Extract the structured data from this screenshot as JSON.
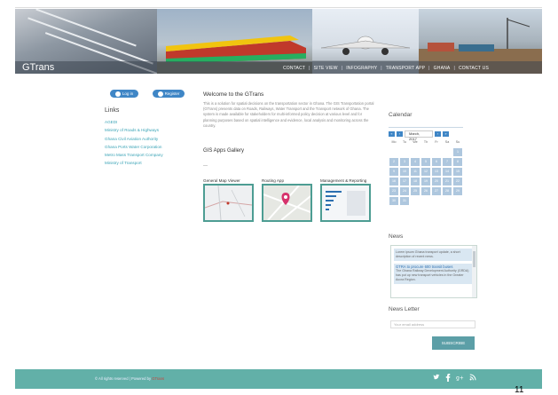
{
  "header": {
    "brand": "GTrans",
    "nav": [
      "CONTACT",
      "SITE VIEW",
      "INFOGRAPHY",
      "TRANSPORT APP",
      "GHANA",
      "CONTACT US"
    ]
  },
  "auth": {
    "login_label": "Log in",
    "register_label": "Register"
  },
  "links": {
    "title": "Links",
    "items": [
      "AGEDI",
      "Ministry of Roads & Highways",
      "Ghana Civil Aviation Authority",
      "Ghana Ports Water Corporation",
      "Metro Mass Transport Company",
      "Ministry of Transport"
    ]
  },
  "welcome": {
    "title": "Welcome to the GTrans",
    "body": "This is a solution for spatial decisions on the transportation sector in Ghana. The GIS Transportation portal (GTrans) presents data on Roads, Railways, Water Transport and the Transport network of Ghana. The system is made available for stakeholders for multi-informed policy decision at various level and for planning purposes based on spatial intelligence and evidence, local analysis and monitoring across the country."
  },
  "gallery": {
    "title": "GIS Apps Gallery",
    "dash": "—",
    "items": [
      {
        "label": "General Map Viewer"
      },
      {
        "label": "Routing App"
      },
      {
        "label": "Management & Reporting"
      }
    ]
  },
  "calendar": {
    "title": "Calendar",
    "month": "March, 2017",
    "prev": "«",
    "prev2": "‹",
    "next": "›",
    "next2": "»",
    "weekdays": [
      "Mo",
      "Tu",
      "We",
      "Th",
      "Fr",
      "Sa",
      "Su"
    ],
    "days": [
      "1",
      "2",
      "3",
      "4",
      "5",
      "6",
      "7",
      "8",
      "9",
      "10",
      "11",
      "12",
      "13",
      "14",
      "15",
      "16",
      "17",
      "18",
      "19",
      "20",
      "21",
      "22",
      "23",
      "24",
      "25",
      "26",
      "27",
      "28",
      "29",
      "30",
      "31"
    ]
  },
  "news": {
    "title": "News",
    "items": [
      {
        "text": "Lorem ipsum Ghana transport update, a short description of recent news."
      },
      {
        "link": "GTRA to procure 600 transit buses",
        "text": "The Ghana Railway Development Authority (GRDA) has put up new transport vehicles in the Greater Accra Region."
      }
    ]
  },
  "newsletter": {
    "title": "News Letter",
    "placeholder": "Your email address",
    "button": "SUBSCRIBE"
  },
  "footer": {
    "text": "© All rights reserved | Powered by",
    "link": "GTrans",
    "social": [
      "twitter-icon",
      "facebook-icon",
      "google-plus-icon",
      "rss-icon"
    ]
  },
  "page_number": "11"
}
